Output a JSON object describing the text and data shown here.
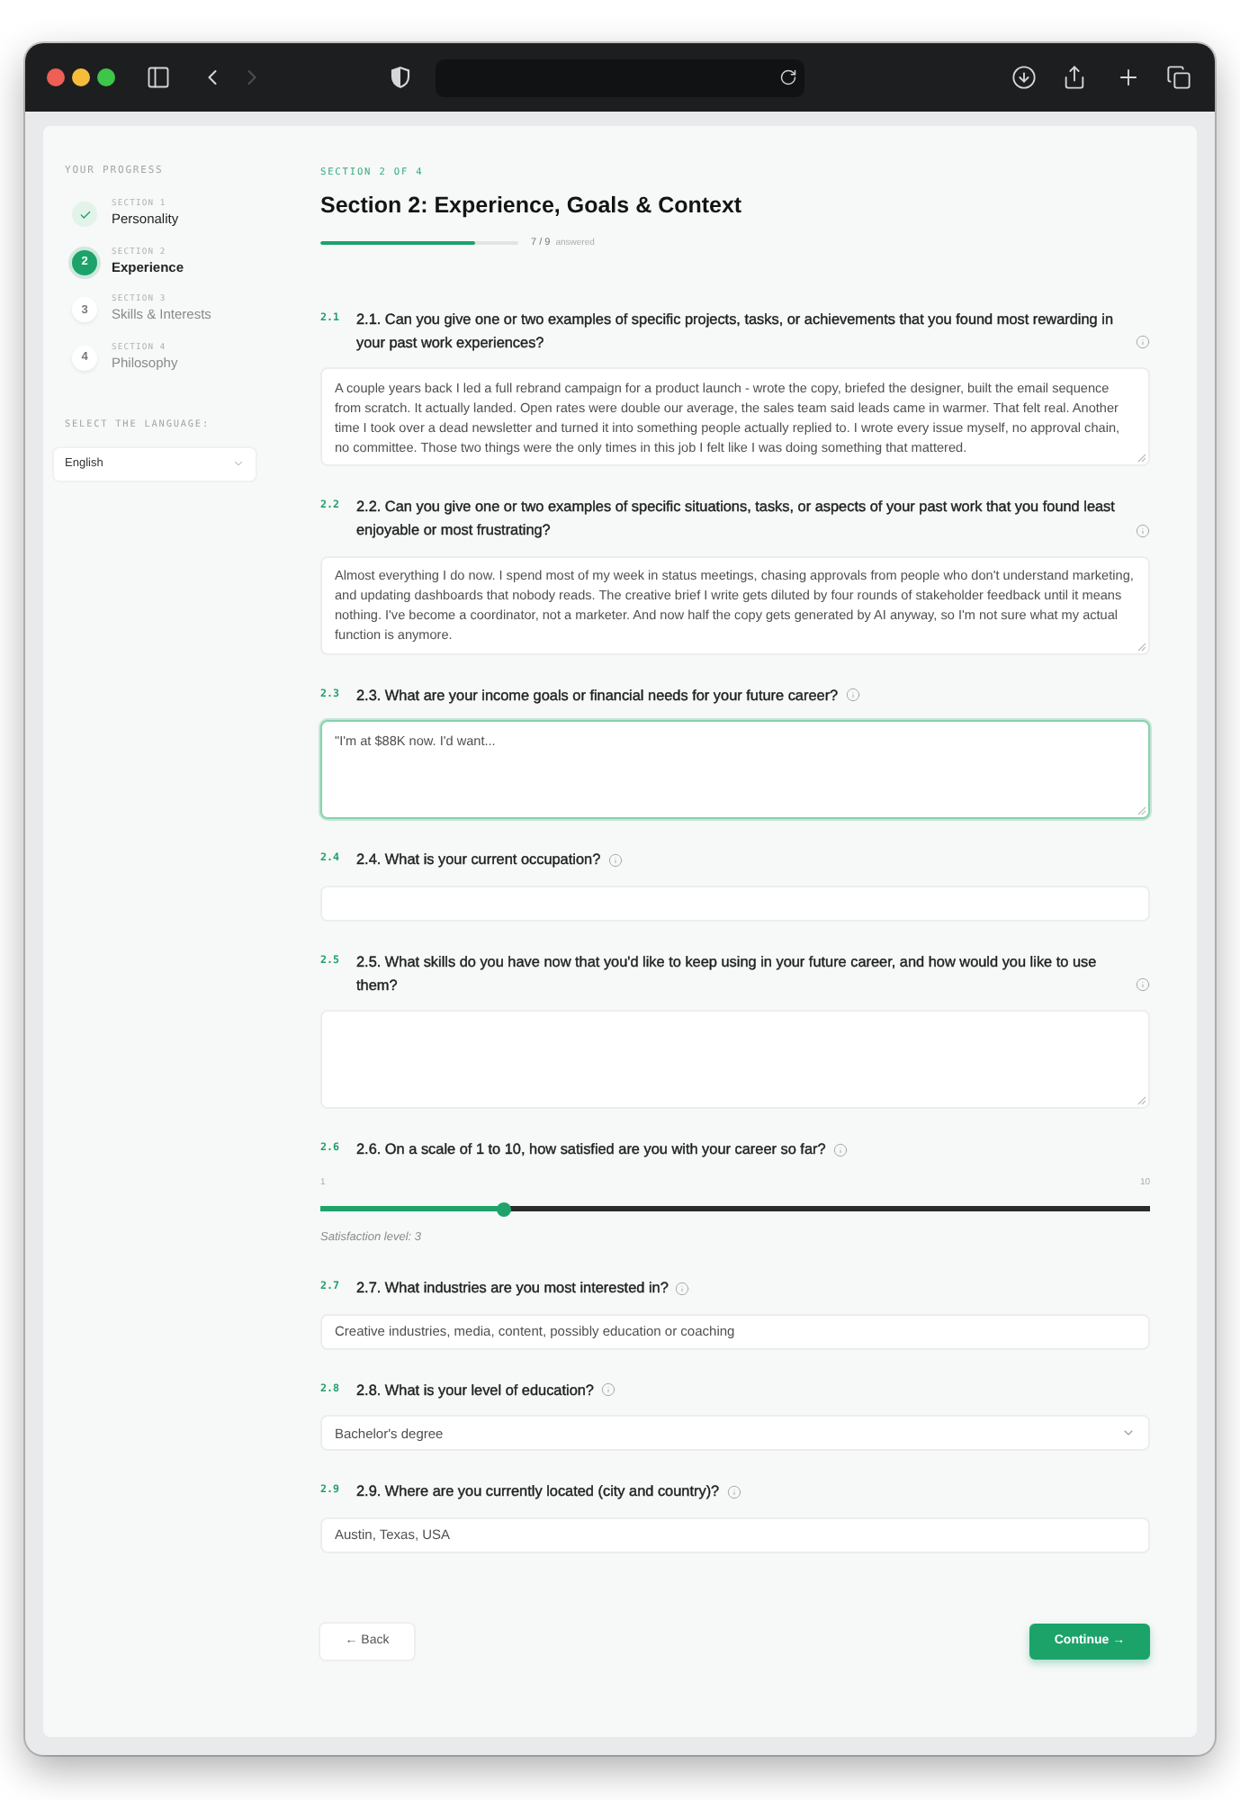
{
  "browser": {
    "nav": [
      {
        "kind": "back",
        "disabled": false
      },
      {
        "kind": "forward",
        "disabled": true
      }
    ]
  },
  "sidebar": {
    "heading": "YOUR PROGRESS",
    "steps": [
      {
        "completed": true,
        "selected": false,
        "section": "SECTION 1",
        "name": "Personality"
      },
      {
        "completed": false,
        "selected": true,
        "marker": "2",
        "section": "SECTION 2",
        "name": "Experience"
      },
      {
        "completed": false,
        "selected": false,
        "marker": "3",
        "section": "SECTION 3",
        "name": "Skills & Interests"
      },
      {
        "completed": false,
        "selected": false,
        "marker": "4",
        "section": "SECTION 4",
        "name": "Philosophy"
      }
    ],
    "language_label": "SELECT THE LANGUAGE:",
    "language": {
      "value": "English"
    }
  },
  "main": {
    "eyebrow": "SECTION 2 OF 4",
    "title": "Section 2: Experience, Goals & Context",
    "progress": {
      "level": 0.78,
      "count": "7 / 9",
      "label": "answered"
    }
  },
  "questions": [
    {
      "kind": "textarea",
      "number": "2.1",
      "text": "2.1. Can you give one or two examples of specific projects, tasks, or achievements that you found most rewarding in your past work experiences?",
      "value": "A couple years back I led a full rebrand campaign for a product launch - wrote the copy, briefed the designer, built the email sequence from scratch. It actually landed. Open rates were double our average, the sales team said leads came in warmer. That felt real. Another time I took over a dead newsletter and turned it into something people actually replied to. I wrote every issue myself, no approval chain, no committee. Those two things were the only times in this job I felt like I was doing something that mattered.",
      "focused": false
    },
    {
      "kind": "textarea",
      "number": "2.2",
      "text": "2.2. Can you give one or two examples of specific situations, tasks, or aspects of your past work that you found least enjoyable or most frustrating?",
      "value": "Almost everything I do now. I spend most of my week in status meetings, chasing approvals from people who don't understand marketing, and updating dashboards that nobody reads. The creative brief I write gets diluted by four rounds of stakeholder feedback until it means nothing. I've become a coordinator, not a marketer. And now half the copy gets generated by AI anyway, so I'm not sure what my actual function is anymore.",
      "focused": false
    },
    {
      "kind": "textarea",
      "number": "2.3",
      "text": "2.3. What are your income goals or financial needs for your future career?",
      "value": "\"I'm at $88K now. I'd want...",
      "focused": true
    },
    {
      "kind": "input",
      "number": "2.4",
      "text": "2.4. What is your current occupation?",
      "focused": false
    },
    {
      "kind": "textarea",
      "number": "2.5",
      "text": "2.5. What skills do you have now that you'd like to keep using in your future career, and how would you like to use them?",
      "focused": false
    },
    {
      "kind": "slider",
      "number": "2.6",
      "text": "2.6. On a scale of 1 to 10, how satisfied are you with your career so far?",
      "min_label": "1",
      "max_label": "10",
      "level": 0.222,
      "caption": "Satisfaction level: 3",
      "focused": false
    },
    {
      "kind": "input",
      "number": "2.7",
      "text": "2.7. What industries are you most interested in?",
      "value": "Creative industries, media, content, possibly education or coaching",
      "focused": false
    },
    {
      "kind": "select",
      "number": "2.8",
      "text": "2.8. What is your level of education?",
      "value": "Bachelor's degree",
      "focused": false
    },
    {
      "kind": "input",
      "number": "2.9",
      "text": "2.9. Where are you currently located (city and country)?",
      "value": "Austin, Texas, USA",
      "focused": false
    }
  ],
  "footer": {
    "back": "← Back",
    "continue": "Continue →"
  }
}
